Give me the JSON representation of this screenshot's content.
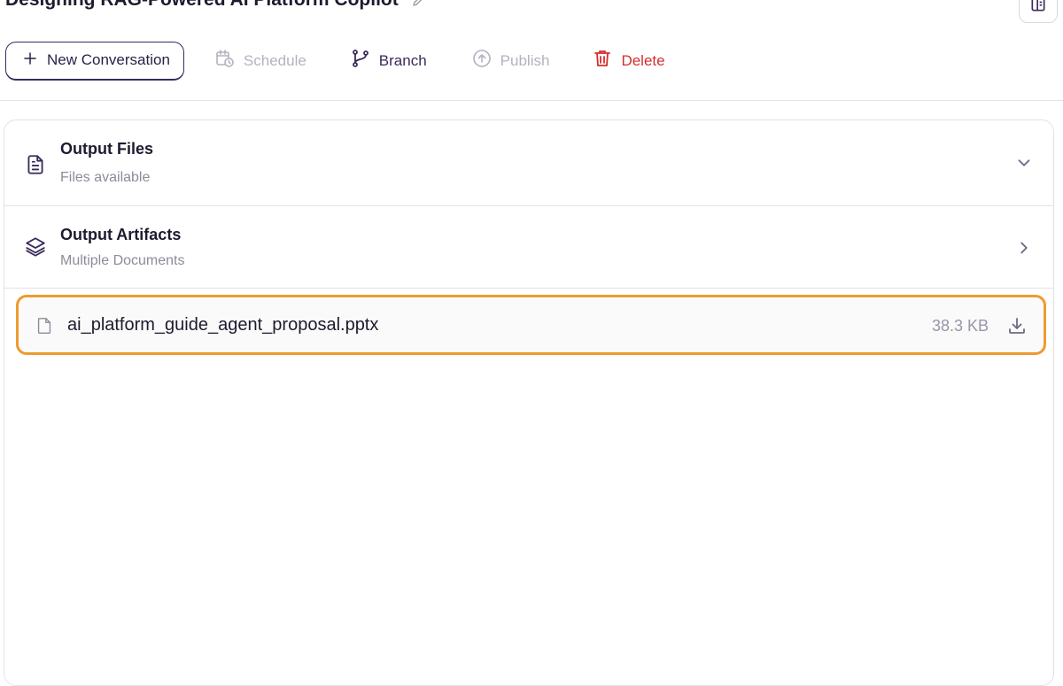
{
  "header": {
    "title": "Designing RAG-Powered AI Platform Copilot"
  },
  "toolbar": {
    "new_conversation": "New Conversation",
    "schedule": "Schedule",
    "branch": "Branch",
    "publish": "Publish",
    "delete": "Delete"
  },
  "sections": {
    "output_files": {
      "title": "Output Files",
      "subtitle": "Files available",
      "state": "expanded"
    },
    "output_artifacts": {
      "title": "Output Artifacts",
      "subtitle": "Multiple Documents",
      "state": "collapsed"
    }
  },
  "file": {
    "name": "ai_platform_guide_agent_proposal.pptx",
    "size": "38.3 KB"
  },
  "colors": {
    "accent": "#3b2a5c",
    "delete": "#d62d2d",
    "highlight": "#ef9a31",
    "disabled": "#b5b1c0"
  }
}
